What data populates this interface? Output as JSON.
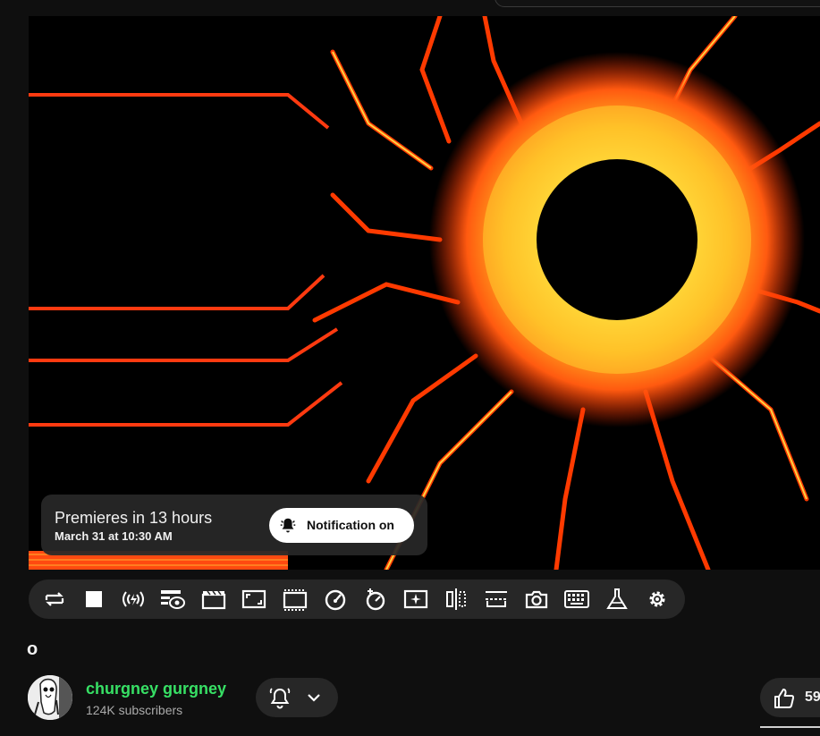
{
  "player": {
    "premiere_title": "Premieres in 13 hours",
    "premiere_date": "March 31 at 10:30 AM",
    "notify_label": "Notification on"
  },
  "toolbar": {
    "buttons": [
      {
        "icon": "loop-icon"
      },
      {
        "icon": "stop-icon"
      },
      {
        "icon": "live-signal-icon"
      },
      {
        "icon": "watch-later-eye-icon"
      },
      {
        "icon": "clapperboard-icon"
      },
      {
        "icon": "aspect-ratio-icon"
      },
      {
        "icon": "cinema-mode-icon"
      },
      {
        "icon": "speedometer-icon"
      },
      {
        "icon": "speed-plus-icon"
      },
      {
        "icon": "ambient-sparkle-icon"
      },
      {
        "icon": "mirror-icon"
      },
      {
        "icon": "subtitle-position-icon"
      },
      {
        "icon": "screenshot-camera-icon"
      },
      {
        "icon": "keyboard-icon"
      },
      {
        "icon": "flask-icon"
      },
      {
        "icon": "settings-gear-icon"
      }
    ]
  },
  "video": {
    "title": "o"
  },
  "channel": {
    "name": "churgney gurgney",
    "subscribers": "124K subscribers",
    "name_color": "#37e065"
  },
  "actions": {
    "like_count": "59"
  }
}
